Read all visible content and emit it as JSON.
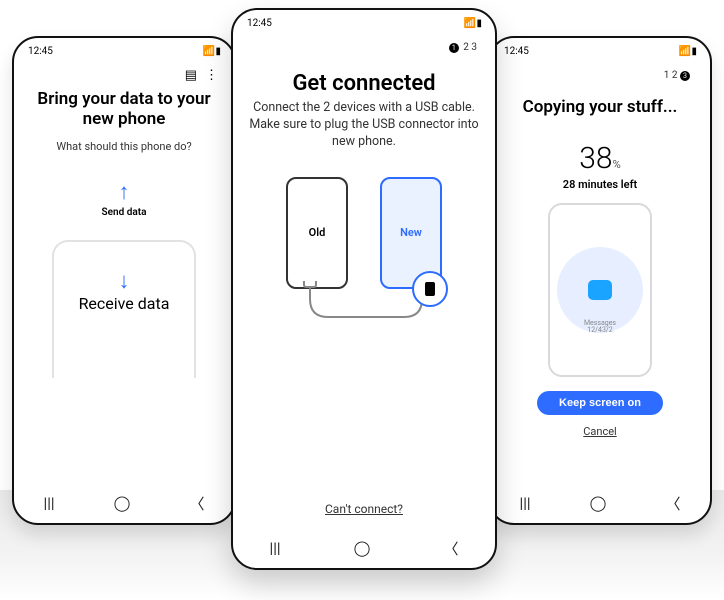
{
  "status": {
    "time": "12:45",
    "icons": "📶 ▮"
  },
  "left": {
    "title": "Bring your data to your new phone",
    "subtitle": "What should this phone do?",
    "sendLabel": "Send data",
    "receiveLabel": "Receive data"
  },
  "center": {
    "pager": {
      "current": "1",
      "rest": "2  3"
    },
    "title": "Get connected",
    "subtitle": "Connect the 2 devices with a USB cable. Make sure to plug the USB connector into new phone.",
    "oldLabel": "Old",
    "newLabel": "New",
    "cantConnect": "Can't connect?"
  },
  "right": {
    "pager": {
      "rest": "1  2",
      "current": "3"
    },
    "title": "Copying your stuff...",
    "percent": "38",
    "percentUnit": "%",
    "eta": "28 minutes left",
    "itemLabel": "Messages",
    "itemCount": "12/43/2",
    "keepScreen": "Keep screen on",
    "cancel": "Cancel"
  },
  "nav": {
    "recents": "|||",
    "home": "◯",
    "back": "〈"
  }
}
